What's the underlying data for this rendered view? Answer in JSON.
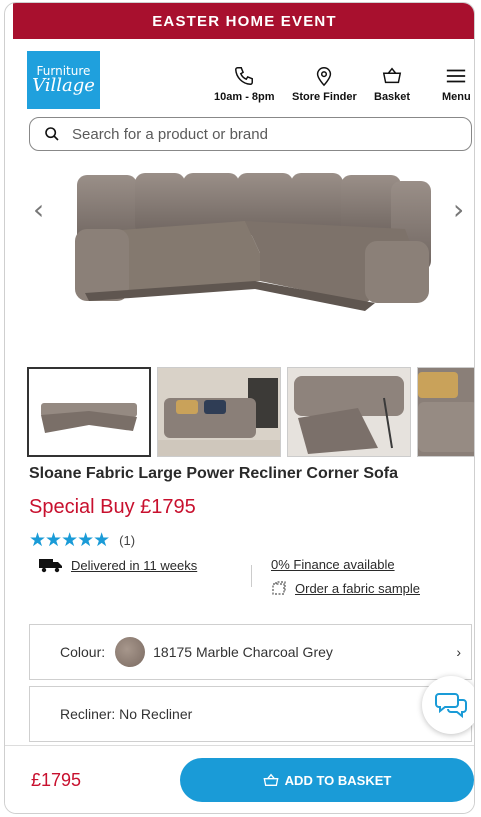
{
  "promo": {
    "text": "EASTER HOME EVENT"
  },
  "header": {
    "logo_line1": "Furniture",
    "logo_line2": "Village",
    "nav": [
      {
        "label": "10am - 8pm",
        "icon": "phone-icon"
      },
      {
        "label": "Store Finder",
        "icon": "location-pin-icon"
      },
      {
        "label": "Basket",
        "icon": "basket-icon"
      },
      {
        "label": "Menu",
        "icon": "hamburger-menu-icon"
      }
    ]
  },
  "search": {
    "placeholder": "Search for a product or brand"
  },
  "gallery": {
    "prev": "‹",
    "next": "›"
  },
  "product": {
    "title": "Sloane Fabric Large Power Recliner Corner Sofa",
    "price_label": "Special Buy £1795",
    "stars": "★★★★★",
    "rating_value": 5,
    "review_count": "(1)"
  },
  "links": {
    "delivery": "Delivered in 11 weeks",
    "finance": "0% Finance available",
    "sample": "Order a fabric sample"
  },
  "options": {
    "colour_label": "Colour:",
    "colour_value": "18175 Marble Charcoal Grey",
    "recliner_text": "Recliner: No Recliner",
    "chevron": "›"
  },
  "bottom": {
    "price": "£1795",
    "add_label": "ADD TO BASKET"
  },
  "colors": {
    "brand_red": "#a8102e",
    "price_red": "#c8102e",
    "brand_blue": "#1a9bd7"
  }
}
